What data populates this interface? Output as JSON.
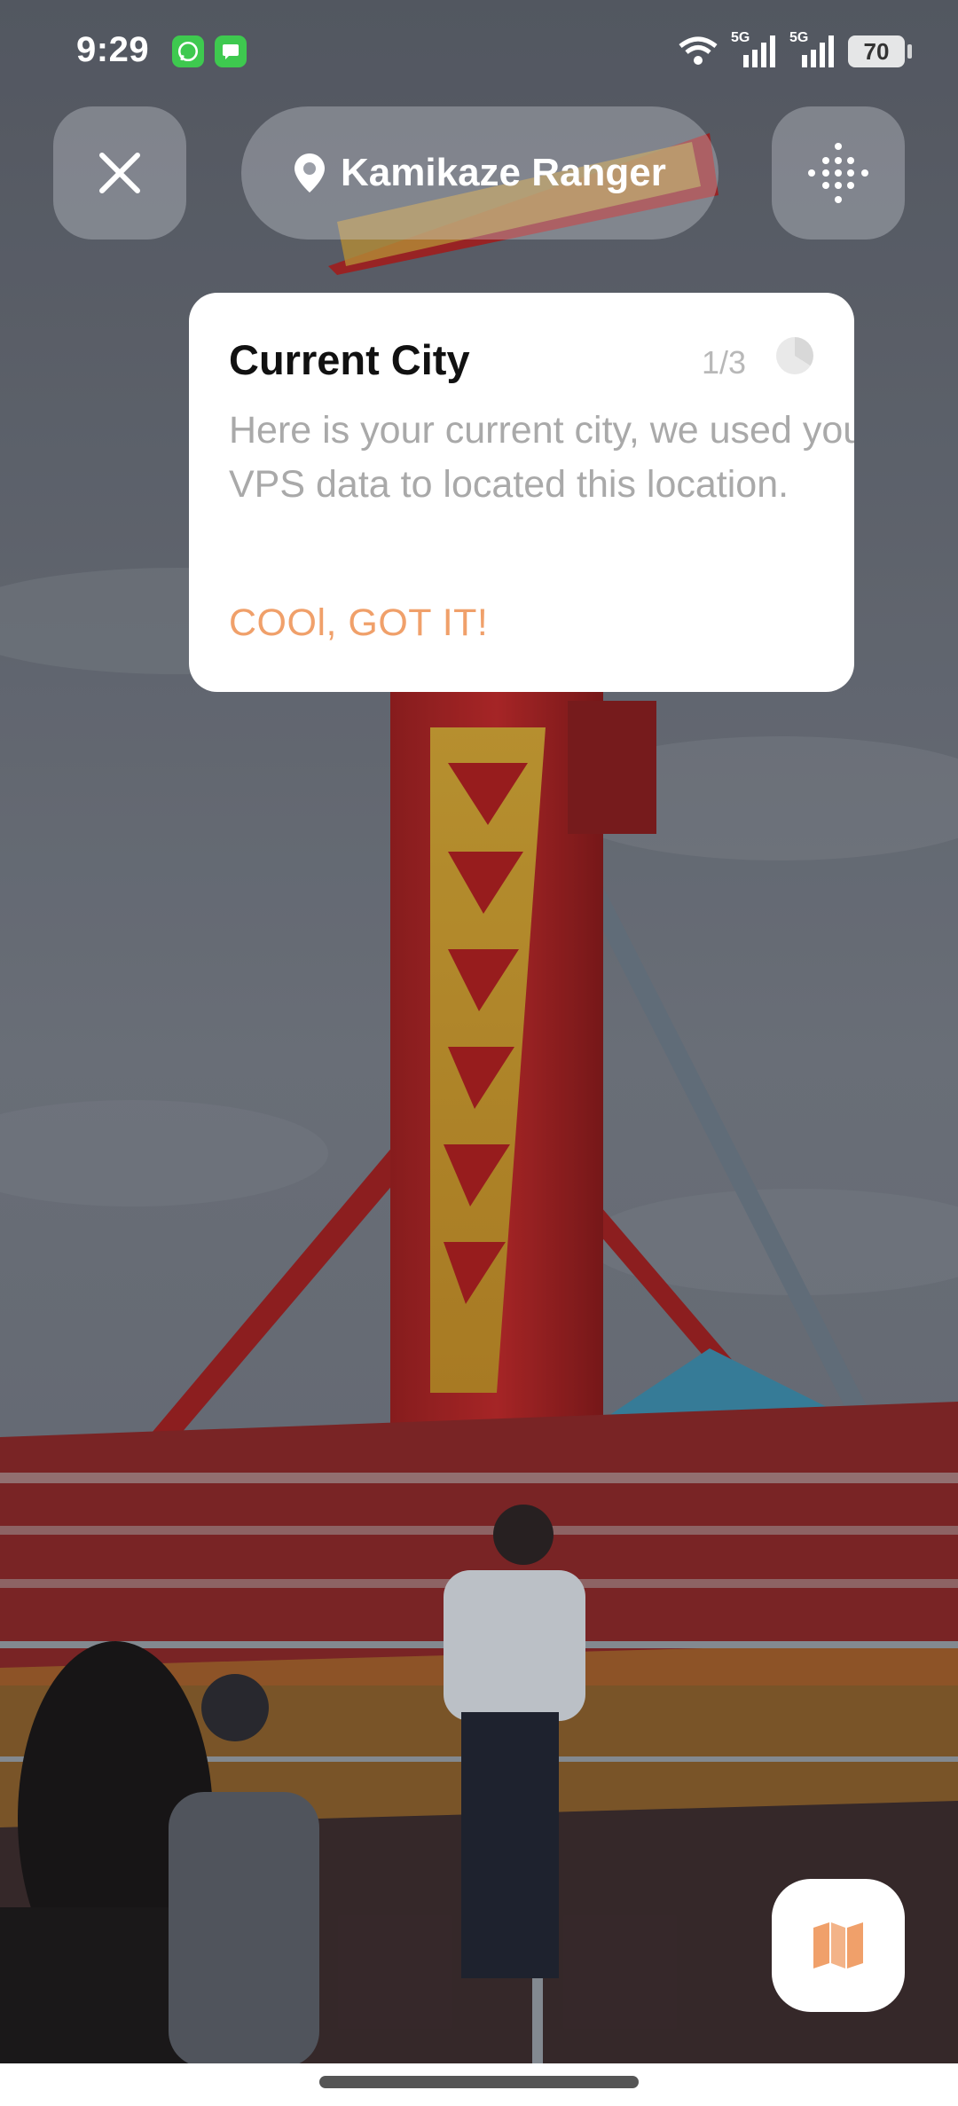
{
  "status_bar": {
    "time": "9:29",
    "network_1": "5G",
    "network_2": "5G",
    "battery": "70"
  },
  "header": {
    "location_name": "Kamikaze Ranger",
    "close_icon": "close-icon",
    "menu_icon": "dots-grid-icon",
    "pin_icon": "location-pin-icon"
  },
  "tooltip": {
    "title": "Current City",
    "counter": "1/3",
    "body": "Here is your current city, we used your VPS data to located this location.",
    "cta": "COOl, GOT IT!"
  },
  "map_button": {
    "icon": "map-icon",
    "accent": "#f0a06a"
  }
}
